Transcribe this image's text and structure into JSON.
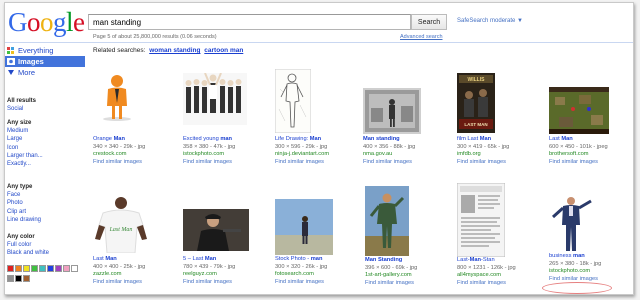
{
  "header": {
    "logo_letters": [
      "G",
      "o",
      "o",
      "g",
      "l",
      "e"
    ],
    "search_value": "man standing",
    "search_button": "Search",
    "safesearch": "SafeSearch moderate ▼",
    "stats": "Page 5 of about 25,800,000 results (0.06 seconds)",
    "advanced": "Advanced search"
  },
  "related": {
    "label": "Related searches:",
    "items": [
      "woman standing",
      "cartoon man"
    ]
  },
  "sidebar": {
    "nav": [
      {
        "label": "Everything",
        "icon": "everything-icon"
      },
      {
        "label": "Images",
        "icon": "images-icon"
      },
      {
        "label": "More",
        "icon": "more-icon"
      }
    ],
    "results_section": {
      "header": "All results",
      "items": [
        "Social"
      ]
    },
    "size_section": {
      "header": "Any size",
      "items": [
        "Medium",
        "Large",
        "Icon",
        "Larger than...",
        "Exactly..."
      ]
    },
    "type_section": {
      "header": "Any type",
      "items": [
        "Face",
        "Photo",
        "Clip art",
        "Line drawing"
      ]
    },
    "color_section": {
      "header": "Any color",
      "items": [
        "Full color",
        "Black and white"
      ]
    },
    "swatch_colors": [
      "#e02020",
      "#f08020",
      "#f0e020",
      "#40c040",
      "#40c0c0",
      "#2040e0",
      "#a040c0",
      "#f0a0c0",
      "#ffffff",
      "#909090",
      "#000000",
      "#a06030"
    ]
  },
  "results": [
    {
      "title_pre": "Orange ",
      "title_bold": "Man",
      "title_post": "",
      "meta": "340 × 340 - 29k - jpg",
      "source": "crestock.com",
      "similar": "Find similar images"
    },
    {
      "title_pre": "Excited young ",
      "title_bold": "man",
      "title_post": "",
      "meta": "358 × 380 - 47k - jpg",
      "source": "istockphoto.com",
      "similar": "Find similar images"
    },
    {
      "title_pre": "Life Drawing: ",
      "title_bold": "Man",
      "title_post": "",
      "meta": "300 × 596 - 29k - jpg",
      "source": "ninja-j.deviantart.com",
      "similar": "Find similar images"
    },
    {
      "title_pre": "",
      "title_bold": "Man standing",
      "title_post": "",
      "meta": "400 × 356 - 88k - jpg",
      "source": "nma.gov.au",
      "similar": "Find similar images"
    },
    {
      "title_pre": "film Last ",
      "title_bold": "Man",
      "title_post": "",
      "meta": "300 × 419 - 65k - jpg",
      "source": "imfdb.org",
      "similar": "Find similar images"
    },
    {
      "title_pre": "Last ",
      "title_bold": "Man",
      "title_post": "",
      "meta": "600 × 450 - 101k - jpeg",
      "source": "brothersoft.com",
      "similar": "Find similar images"
    },
    {
      "title_pre": "Last ",
      "title_bold": "Man",
      "title_post": "",
      "meta": "400 × 400 - 25k - jpg",
      "source": "zazzle.com",
      "similar": "Find similar images"
    },
    {
      "title_pre": "5 – Last ",
      "title_bold": "Man",
      "title_post": "",
      "meta": "780 × 439 - 79k - jpg",
      "source": "reelguyz.com",
      "similar": "Find similar images"
    },
    {
      "title_pre": "Stock Photo - ",
      "title_bold": "man",
      "title_post": "",
      "meta": "300 × 320 - 26k - jpg",
      "source": "fotosearch.com",
      "similar": "Find similar images"
    },
    {
      "title_pre": "",
      "title_bold": "Man Standing",
      "title_post": "",
      "meta": "396 × 600 - 69k - jpg",
      "source": "1st-art-gallery.com",
      "similar": "Find similar images"
    },
    {
      "title_pre": "Last-",
      "title_bold": "Man",
      "title_post": "-Stan",
      "meta": "800 × 1231 - 126k - jpg",
      "source": "all4myspace.com",
      "similar": "Find similar images"
    },
    {
      "title_pre": "business ",
      "title_bold": "man",
      "title_post": "",
      "meta": "265 × 380 - 18k - jpg",
      "source": "istockphoto.com",
      "similar": "Find similar images"
    }
  ]
}
